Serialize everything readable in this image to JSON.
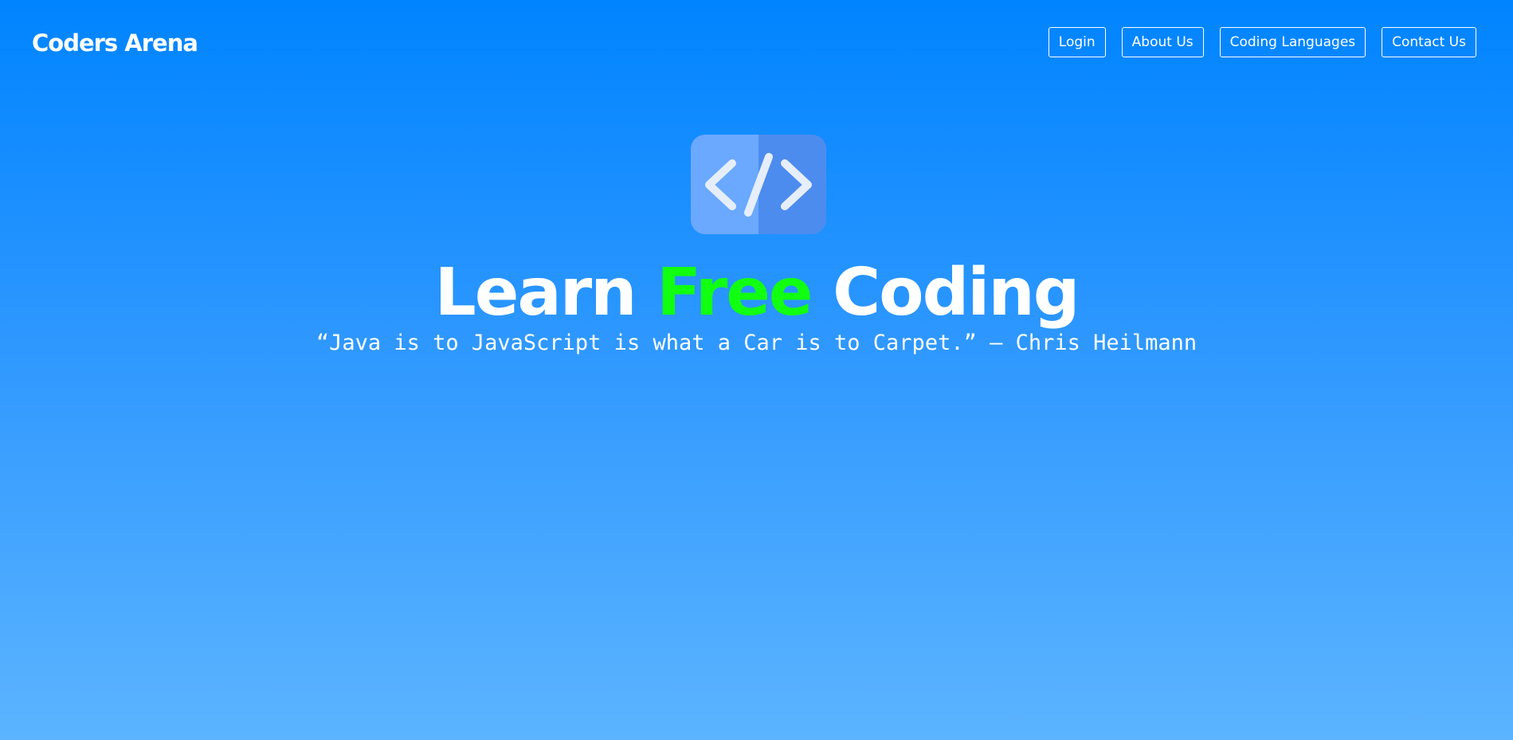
{
  "header": {
    "brand": "Coders Arena",
    "nav": [
      {
        "label": "Login"
      },
      {
        "label": "About Us"
      },
      {
        "label": "Coding Languages"
      },
      {
        "label": "Contact Us"
      }
    ]
  },
  "hero": {
    "logo_icon": "code-brackets-icon",
    "headline": {
      "part1": "Learn ",
      "accent": "Free",
      "part2": " Coding"
    },
    "quote": "“Java is to JavaScript is what a Car is to Carpet.” – Chris Heilmann"
  },
  "colors": {
    "background_top": "#0084ff",
    "background_bottom": "#5cb4ff",
    "accent_green": "#11ff11",
    "logo_left": "#6aa9ff",
    "logo_right": "#4d8cef"
  }
}
